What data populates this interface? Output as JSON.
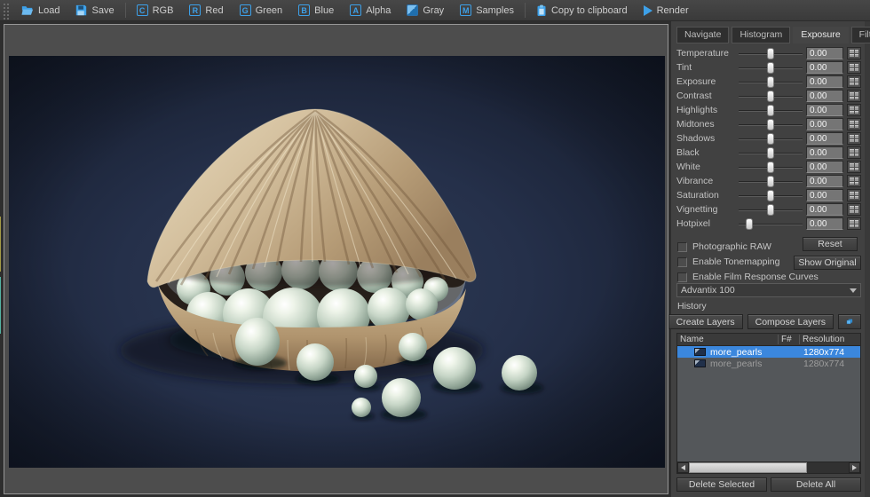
{
  "toolbar": {
    "items": [
      {
        "label": "Load"
      },
      {
        "label": "Save"
      },
      {
        "label": "RGB",
        "glyph": "C"
      },
      {
        "label": "Red",
        "glyph": "R"
      },
      {
        "label": "Green",
        "glyph": "G"
      },
      {
        "label": "Blue",
        "glyph": "B"
      },
      {
        "label": "Alpha",
        "glyph": "A"
      },
      {
        "label": "Gray"
      },
      {
        "label": "Samples",
        "glyph": "M"
      },
      {
        "label": "Copy to clipboard"
      },
      {
        "label": "Render"
      }
    ]
  },
  "panel": {
    "tabs": [
      "Navigate",
      "Histogram",
      "Exposure",
      "Filter"
    ],
    "active_tab": "Exposure",
    "sliders": [
      {
        "label": "Temperature",
        "value": "0.00",
        "thumb_pct": 50
      },
      {
        "label": "Tint",
        "value": "0.00",
        "thumb_pct": 50
      },
      {
        "label": "Exposure",
        "value": "0.00",
        "thumb_pct": 50
      },
      {
        "label": "Contrast",
        "value": "0.00",
        "thumb_pct": 50
      },
      {
        "label": "Highlights",
        "value": "0.00",
        "thumb_pct": 50
      },
      {
        "label": "Midtones",
        "value": "0.00",
        "thumb_pct": 50
      },
      {
        "label": "Shadows",
        "value": "0.00",
        "thumb_pct": 50
      },
      {
        "label": "Black",
        "value": "0.00",
        "thumb_pct": 50
      },
      {
        "label": "White",
        "value": "0.00",
        "thumb_pct": 50
      },
      {
        "label": "Vibrance",
        "value": "0.00",
        "thumb_pct": 50
      },
      {
        "label": "Saturation",
        "value": "0.00",
        "thumb_pct": 50
      },
      {
        "label": "Vignetting",
        "value": "0.00",
        "thumb_pct": 50
      },
      {
        "label": "Hotpixel",
        "value": "0.00",
        "thumb_pct": 17
      }
    ],
    "checkboxes": [
      "Photographic RAW",
      "Enable Tonemapping",
      "Enable Film Response Curves"
    ],
    "reset_label": "Reset",
    "show_original_label": "Show Original",
    "film_response": "Advantix 100",
    "history": {
      "title": "History",
      "create_layers_label": "Create Layers",
      "compose_layers_label": "Compose Layers",
      "columns": [
        "Name",
        "F#",
        "Resolution"
      ],
      "rows": [
        {
          "name": "more_pearls",
          "f_number": "",
          "resolution": "1280x774",
          "selected": true
        },
        {
          "name": "more_pearls",
          "f_number": "",
          "resolution": "1280x774",
          "selected": false
        }
      ],
      "delete_selected_label": "Delete Selected",
      "delete_all_label": "Delete All"
    }
  },
  "colors": {
    "accent_blue": "#3da0e8",
    "selection_blue": "#3b87dd"
  }
}
